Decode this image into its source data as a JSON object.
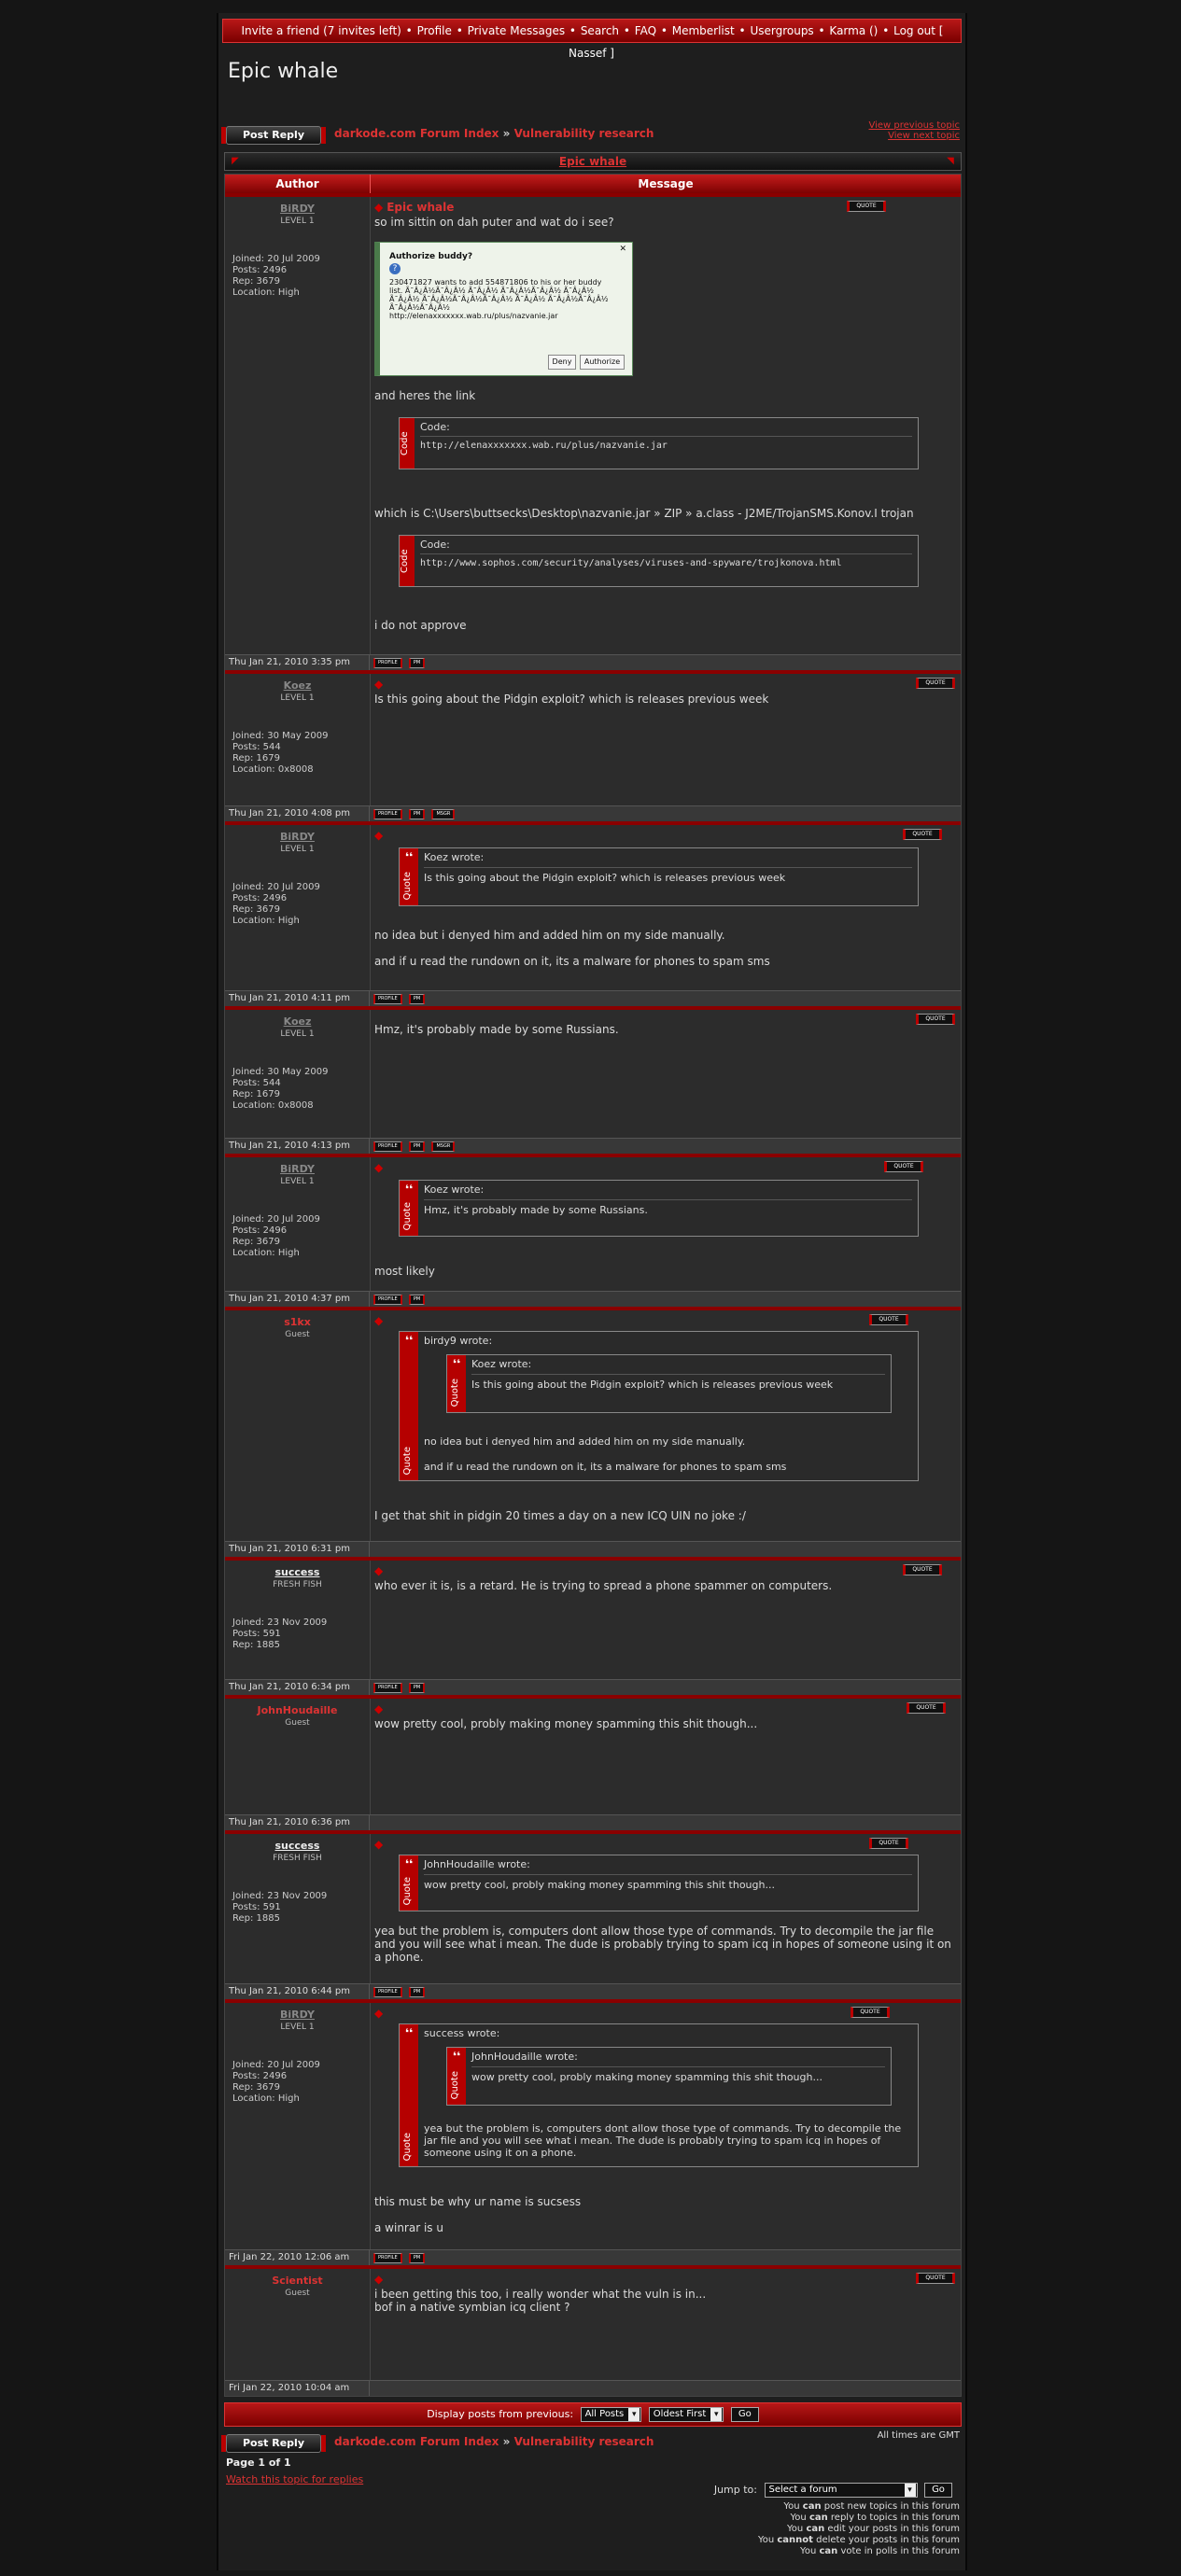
{
  "nav": [
    "Invite a friend (7 invites left)",
    "Profile",
    "Private Messages",
    "Search",
    "FAQ",
    "Memberlist",
    "Usergroups",
    "Karma ()",
    "Log out [ Nassef ]"
  ],
  "page_title": "Epic whale",
  "reply_label": "Post Reply",
  "breadcrumb": {
    "forum": "darkode.com Forum Index",
    "sep": "»",
    "section": "Vulnerability research"
  },
  "prev_topic": "View previous topic",
  "next_topic": "View next topic",
  "topic_title": "Epic whale",
  "col_author": "Author",
  "col_message": "Message",
  "labels": {
    "quote": "QUOTE",
    "profile": "PROFILE",
    "pm": "PM",
    "msgr": "MSGR",
    "code": "Code:",
    "code_side": "Code",
    "quote_side": "Quote"
  },
  "p1": {
    "name": "BiRDY",
    "rank": "LEVEL 1",
    "stats": [
      "Joined: 20 Jul 2009",
      "Posts: 2496",
      "Rep: 3679",
      "Location: High"
    ],
    "title": "Epic whale",
    "line1": "so im sittin on dah puter and wat do i see?",
    "dialog_title": "Authorize buddy?",
    "dialog_body": "230471827 wants to add 554871806 to his or her buddy list. Ã¯Â¿Â½Ã¯Â¿Â½ Ã¯Â¿Â½ Ã¯Â¿Â½Ã¯Â¿Â½ Ã¯Â¿Â½ Ã¯Â¿Â½ Ã¯Â¿Â½Ã¯Â¿Â½Ã¯Â¿Â½ Ã¯Â¿Â½ Ã¯Â¿Â½Ã¯Â¿Â½ Ã¯Â¿Â½Ã¯Â¿Â½ http://elenaxxxxxxx.wab.ru/plus/nazvanie.jar",
    "deny": "Deny",
    "authorize": "Authorize",
    "line2": "and heres the link",
    "code1": "http://elenaxxxxxxx.wab.ru/plus/nazvanie.jar",
    "line3": "which is C:\\Users\\buttsecks\\Desktop\\nazvanie.jar » ZIP » a.class - J2ME/TrojanSMS.Konov.I trojan",
    "code2": "http://www.sophos.com/security/analyses/viruses-and-spyware/trojkonova.html",
    "line4": "i do not approve",
    "date": "Thu Jan 21, 2010 3:35 pm"
  },
  "p2": {
    "name": "Koez",
    "rank": "LEVEL 1",
    "stats": [
      "Joined: 30 May 2009",
      "Posts: 544",
      "Rep: 1679",
      "Location: 0x8008"
    ],
    "text": "Is this going about the Pidgin exploit? which is releases previous week",
    "date": "Thu Jan 21, 2010 4:08 pm"
  },
  "p3": {
    "name": "BiRDY",
    "rank": "LEVEL 1",
    "stats": [
      "Joined: 20 Jul 2009",
      "Posts: 2496",
      "Rep: 3679",
      "Location: High"
    ],
    "qwho": "Koez wrote:",
    "qtxt": "Is this going about the Pidgin exploit? which is releases previous week",
    "line1": "no idea but i denyed him and added him on my side manually.",
    "line2": "and if u read the rundown on it, its a malware for phones to spam sms",
    "date": "Thu Jan 21, 2010 4:11 pm"
  },
  "p4": {
    "name": "Koez",
    "rank": "LEVEL 1",
    "stats": [
      "Joined: 30 May 2009",
      "Posts: 544",
      "Rep: 1679",
      "Location: 0x8008"
    ],
    "text": "Hmz, it's probably made by some Russians.",
    "date": "Thu Jan 21, 2010 4:13 pm"
  },
  "p5": {
    "name": "BiRDY",
    "rank": "LEVEL 1",
    "stats": [
      "Joined: 20 Jul 2009",
      "Posts: 2496",
      "Rep: 3679",
      "Location: High"
    ],
    "qwho": "Koez wrote:",
    "qtxt": "Hmz, it's probably made by some Russians.",
    "text": "most likely",
    "date": "Thu Jan 21, 2010 4:37 pm"
  },
  "p6": {
    "name": "s1kx",
    "rank": "Guest",
    "qwho": "birdy9 wrote:",
    "q2who": "Koez wrote:",
    "q2txt": "Is this going about the Pidgin exploit? which is releases previous week",
    "qline1": "no idea but i denyed him and added him on my side manually.",
    "qline2": "and if u read the rundown on it, its a malware for phones to spam sms",
    "text": "I get that shit in pidgin 20 times a day on a new ICQ UIN no joke :/",
    "date": "Thu Jan 21, 2010 6:31 pm"
  },
  "p7": {
    "name": "success",
    "rank": "FRESH FISH",
    "stats": [
      "Joined: 23 Nov 2009",
      "Posts: 591",
      "Rep: 1885"
    ],
    "text": "who ever it is, is a retard. He is trying to spread a phone spammer on computers.",
    "date": "Thu Jan 21, 2010 6:34 pm"
  },
  "p8": {
    "name": "JohnHoudaille",
    "rank": "Guest",
    "text": "wow pretty cool, probly making money spamming this shit though...",
    "date": "Thu Jan 21, 2010 6:36 pm"
  },
  "p9": {
    "name": "success",
    "rank": "FRESH FISH",
    "stats": [
      "Joined: 23 Nov 2009",
      "Posts: 591",
      "Rep: 1885"
    ],
    "qwho": "JohnHoudaille wrote:",
    "qtxt": "wow pretty cool, probly making money spamming this shit though...",
    "text": "yea but the problem is, computers dont allow those type of commands. Try to decompile the jar file and you will see what i mean. The dude is probably trying to spam icq in hopes of someone using it on a phone.",
    "date": "Thu Jan 21, 2010 6:44 pm"
  },
  "p10": {
    "name": "BiRDY",
    "rank": "LEVEL 1",
    "stats": [
      "Joined: 20 Jul 2009",
      "Posts: 2496",
      "Rep: 3679",
      "Location: High"
    ],
    "qwho": "success wrote:",
    "q2who": "JohnHoudaille wrote:",
    "q2txt": "wow pretty cool, probly making money spamming this shit though...",
    "qline": "yea but the problem is, computers dont allow those type of commands. Try to decompile the jar file and you will see what i mean. The dude is probably trying to spam icq in hopes of someone using it on a phone.",
    "line1": "this must be why ur name is sucsess",
    "line2": "a winrar is u",
    "date": "Fri Jan 22, 2010 12:06 am"
  },
  "p11": {
    "name": "Scientist",
    "rank": "Guest",
    "line1": "i been getting this too, i really wonder what the vuln is in...",
    "line2": "bof in a native symbian icq client ?",
    "date": "Fri Jan 22, 2010 10:04 am"
  },
  "display_label": "Display posts from previous:",
  "all_posts": "All Posts",
  "oldest_first": "Oldest First",
  "go": "Go",
  "timezone": "All times are GMT",
  "page_of": "Page 1 of 1",
  "watch": "Watch this topic for replies",
  "jump_label": "Jump to:",
  "jump_select": "Select a forum",
  "perms": [
    [
      "You ",
      "can",
      " post new topics in this forum"
    ],
    [
      "You ",
      "can",
      " reply to topics in this forum"
    ],
    [
      "You ",
      "can",
      " edit your posts in this forum"
    ],
    [
      "You ",
      "cannot",
      " delete your posts in this forum"
    ],
    [
      "You ",
      "can",
      " vote in polls in this forum"
    ]
  ],
  "colors": {
    "accent": "#d32b2b",
    "bar": "#a30d0d",
    "bg": "#1e1e1e",
    "post_bg": "#2c2c2c"
  }
}
